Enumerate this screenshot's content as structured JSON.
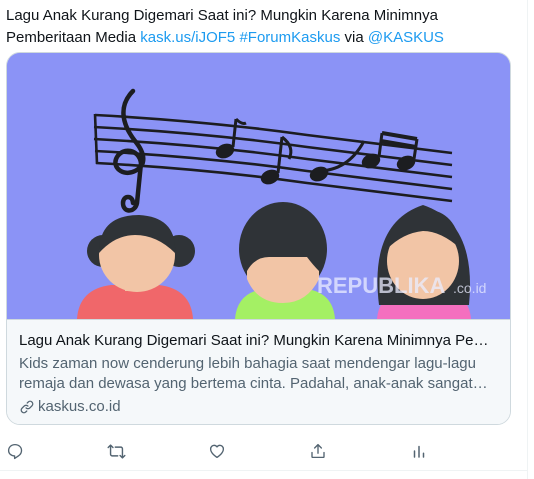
{
  "tweet": {
    "text_line1": "Lagu Anak Kurang Digemari Saat ini? Mungkin Karena Minimnya",
    "text_line2_prefix": "Pemberitaan Media ",
    "link": "kask.us/iJOF5",
    "hashtag": "#ForumKaskus",
    "via": " via ",
    "mention": "@KASKUS"
  },
  "card": {
    "title": "Lagu Anak Kurang Digemari Saat ini? Mungkin Karena Minimnya Pemberitaan Media",
    "description": "Kids zaman now cenderung lebih bahagia saat mendengar lagu-lagu remaja dan dewasa yang bertema cinta. Padahal, anak-anak sangat membutuhkan lagu yang sesuai usianya.",
    "domain": "kaskus.co.id",
    "watermark": "REPUBLIKA",
    "watermark_suffix": ".co.id",
    "colors": {
      "background": "#8b93f6",
      "shirt_left": "#f0676a",
      "shirt_center": "#a4f064",
      "shirt_right": "#f46fbf",
      "skin": "#f2c5a6",
      "hair": "#2f3337"
    }
  },
  "actions": [
    {
      "name": "reply",
      "icon": "reply-icon"
    },
    {
      "name": "retweet",
      "icon": "retweet-icon"
    },
    {
      "name": "like",
      "icon": "heart-icon"
    },
    {
      "name": "share",
      "icon": "share-icon"
    },
    {
      "name": "analytics",
      "icon": "analytics-icon"
    }
  ]
}
